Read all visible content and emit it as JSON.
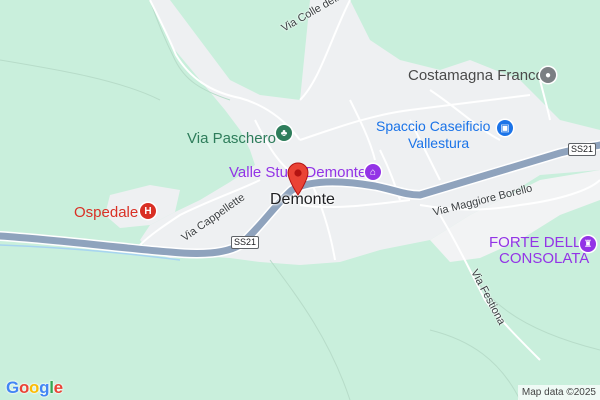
{
  "map": {
    "places": {
      "costamagna": "Costamagna Franco",
      "caseificio_line1": "Spaccio Caseificio",
      "caseificio_line2": "Vallestura",
      "paschero": "Via Paschero",
      "museum": "Valle Stura Demonte",
      "ospedale": "Ospedale",
      "forte_line1": "FORTE DELLA",
      "forte_line2": "CONSOLATA",
      "town": "Demonte"
    },
    "roads": {
      "colle": "Via Colle dell'ortica",
      "cappellette": "Via Cappellette",
      "maggiore": "Via Maggiore Borello",
      "festiona": "Via Festiona",
      "ss21_a": "SS21",
      "ss21_b": "SS21"
    },
    "google_letters": [
      "G",
      "o",
      "o",
      "g",
      "l",
      "e"
    ],
    "attribution": "Map data ©2025"
  },
  "colors": {
    "land": "#c9efdc",
    "urban": "#eef0f2",
    "highway": "#8fa3bd",
    "marker": "#ea4335"
  },
  "icons": [
    "marker-pin-icon",
    "hospital-icon",
    "park-icon",
    "shop-icon",
    "museum-icon",
    "castle-icon",
    "place-icon"
  ]
}
